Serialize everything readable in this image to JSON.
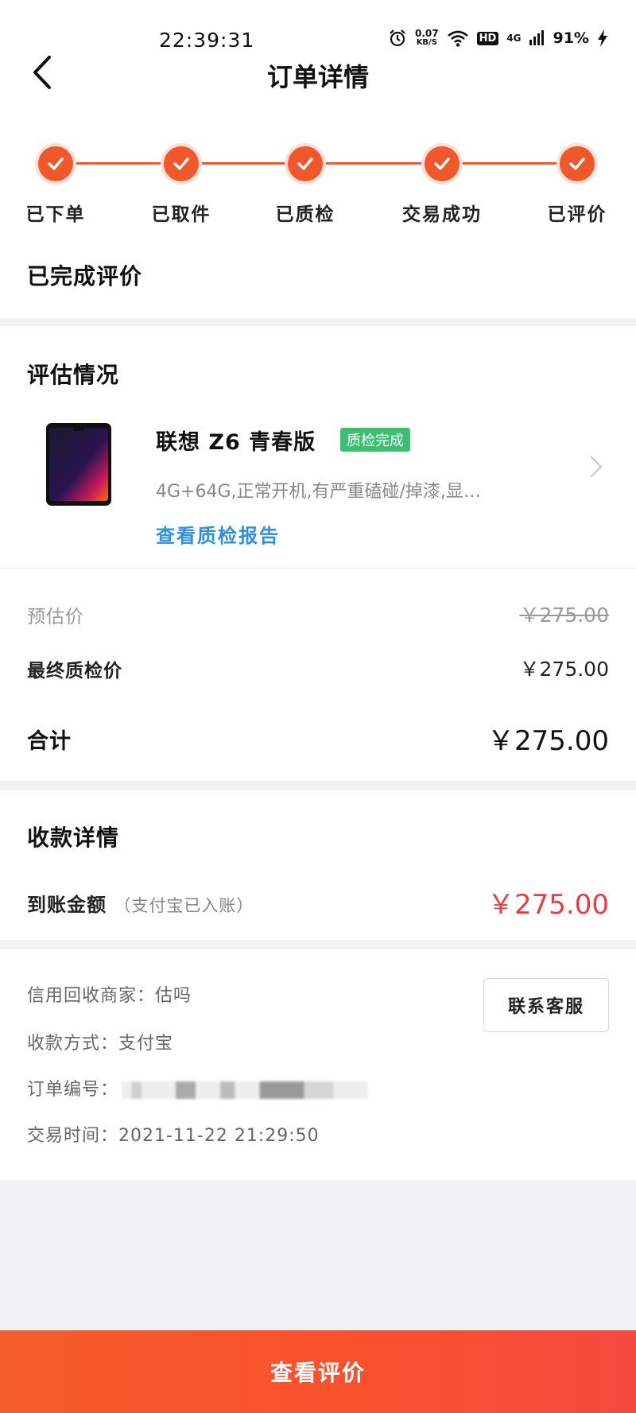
{
  "status_bar": {
    "time": "22:39:31",
    "net_speed_value": "0.07",
    "net_speed_unit": "KB/S",
    "hd_label": "HD",
    "network": "4G",
    "battery": "91%"
  },
  "header": {
    "title": "订单详情"
  },
  "progress": {
    "steps": [
      {
        "label": "已下单"
      },
      {
        "label": "已取件"
      },
      {
        "label": "已质检"
      },
      {
        "label": "交易成功"
      },
      {
        "label": "已评价"
      }
    ],
    "status_text": "已完成评价",
    "accent_color": "#f0582c"
  },
  "evaluation": {
    "title": "评估情况",
    "product_name": "联想 Z6 青春版",
    "badge": "质检完成",
    "spec": "4G+64G,正常开机,有严重磕碰/掉漆,显…",
    "report_link": "查看质检报告",
    "estimated_label": "预估价",
    "estimated_value": "￥275.00",
    "final_label": "最终质检价",
    "final_value": "￥275.00",
    "total_label": "合计",
    "total_value": "￥275.00"
  },
  "payment": {
    "title": "收款详情",
    "amount_label": "到账金额",
    "amount_note": "（支付宝已入账）",
    "amount_value": "￥275.00"
  },
  "info": {
    "merchant": "信用回收商家：估吗",
    "method": "收款方式：支付宝",
    "order_no_label": "订单编号：",
    "trade_time": "交易时间：2021-11-22 21:29:50",
    "contact_button": "联系客服"
  },
  "bottom": {
    "button": "查看评价"
  }
}
